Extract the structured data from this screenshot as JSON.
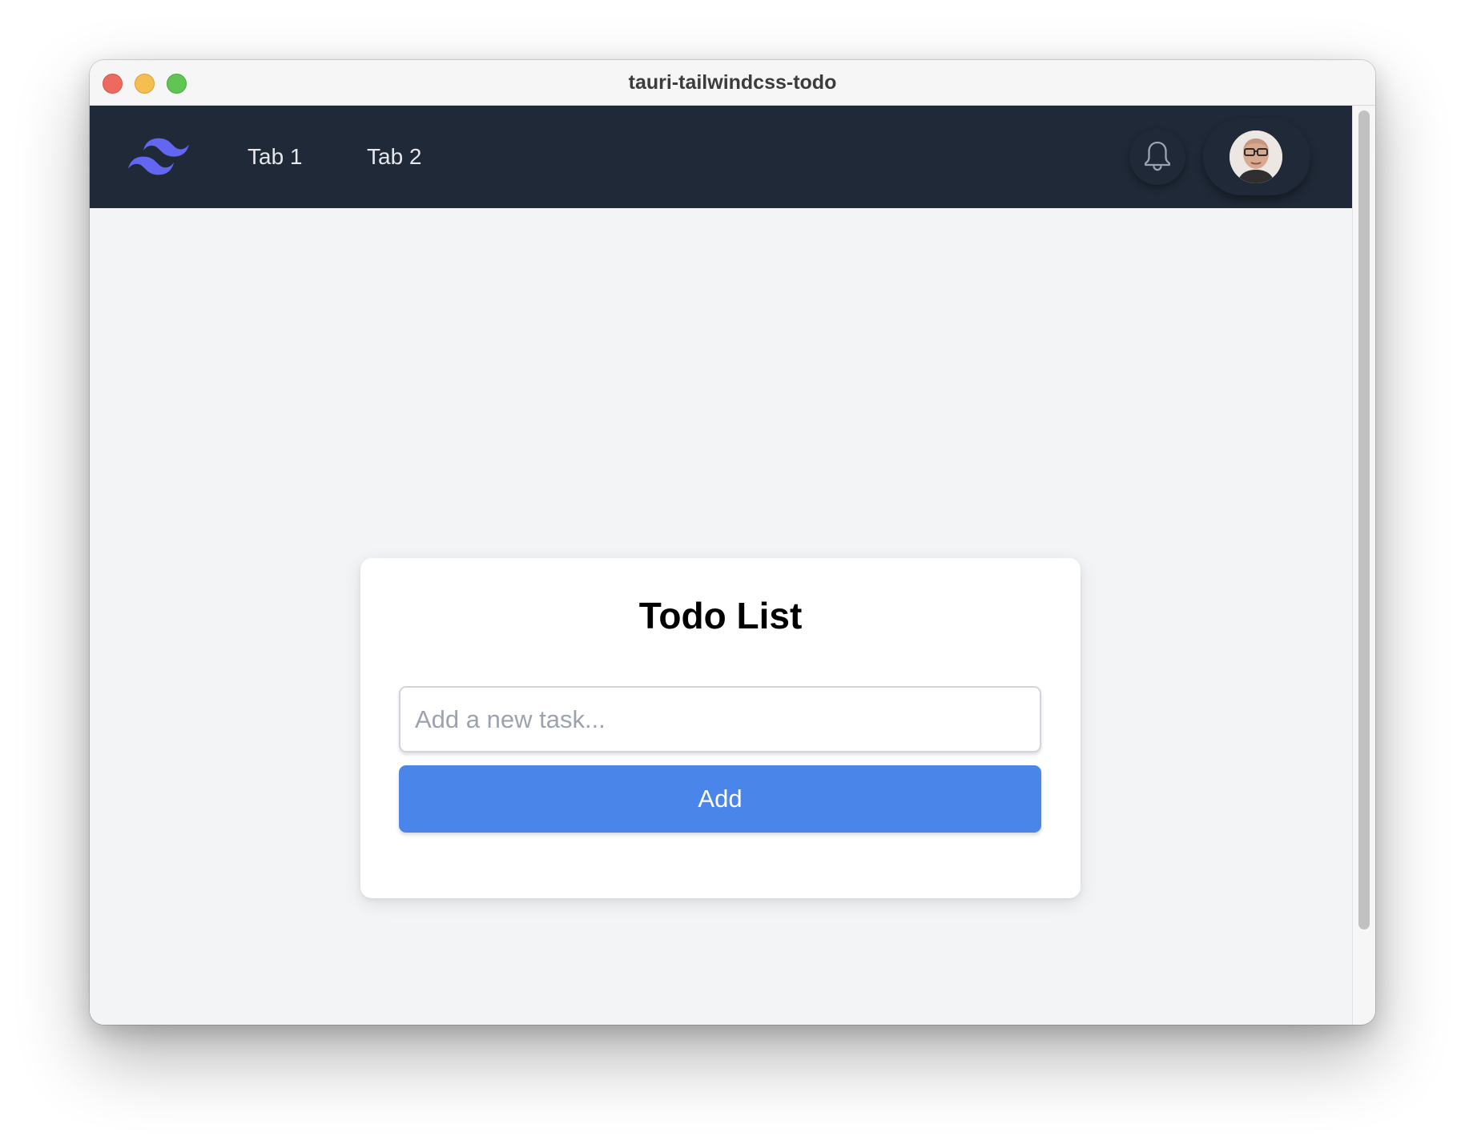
{
  "window": {
    "title": "tauri-tailwindcss-todo"
  },
  "navbar": {
    "logo_icon": "tailwind-logo-icon",
    "tabs": [
      {
        "label": "Tab 1"
      },
      {
        "label": "Tab 2"
      }
    ],
    "notification_icon": "bell-icon",
    "avatar_icon": "user-avatar"
  },
  "todo": {
    "title": "Todo List",
    "input_placeholder": "Add a new task...",
    "input_value": "",
    "add_label": "Add"
  },
  "colors": {
    "navbar_bg": "#1f2937",
    "page_bg": "#f3f4f6",
    "accent_button": "#4a86ea",
    "logo": "#6366f1"
  }
}
